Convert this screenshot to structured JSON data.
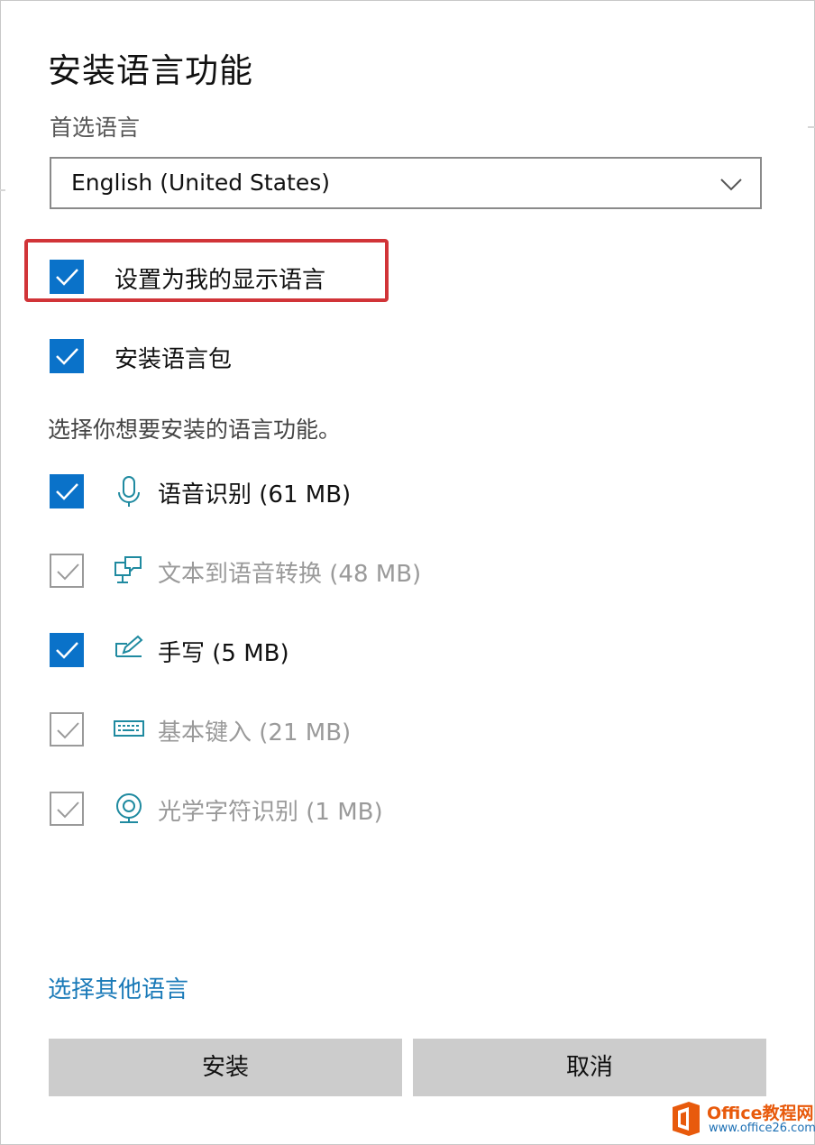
{
  "dialog": {
    "title": "安装语言功能",
    "preferred_language_label": "首选语言",
    "preferred_language_value": "English (United States)",
    "set_display_language": {
      "label": "设置为我的显示语言",
      "checked": true
    },
    "install_language_pack": {
      "label": "安装语言包",
      "checked": true
    },
    "features_hint": "选择你想要安装的语言功能。",
    "features": [
      {
        "label": "语音识别 (61 MB)",
        "checked": true,
        "enabled": true,
        "icon": "microphone-icon"
      },
      {
        "label": "文本到语音转换 (48 MB)",
        "checked": true,
        "enabled": false,
        "icon": "text-to-speech-icon"
      },
      {
        "label": "手写 (5 MB)",
        "checked": true,
        "enabled": true,
        "icon": "handwriting-icon"
      },
      {
        "label": "基本键入 (21 MB)",
        "checked": true,
        "enabled": false,
        "icon": "keyboard-icon"
      },
      {
        "label": "光学字符识别 (1 MB)",
        "checked": true,
        "enabled": false,
        "icon": "ocr-camera-icon"
      }
    ],
    "choose_other_language_link": "选择其他语言",
    "install_button": "安装",
    "cancel_button": "取消"
  },
  "watermark": {
    "brand": "Office教程网",
    "url": "www.office26.com"
  },
  "colors": {
    "accent": "#0a72c9",
    "highlight_border": "#d13438",
    "link": "#1a7ab8",
    "button_bg": "#cccccc",
    "icon_teal": "#1f8aa0"
  }
}
